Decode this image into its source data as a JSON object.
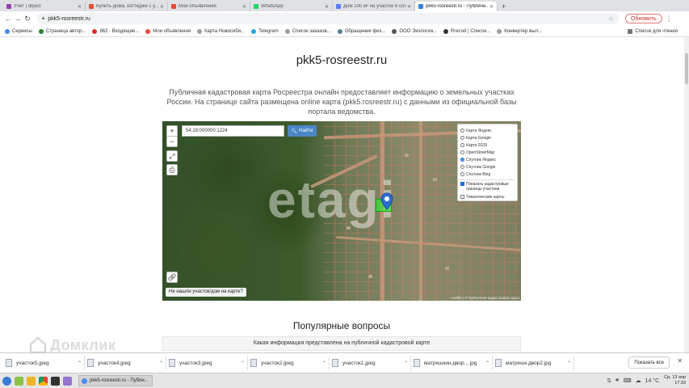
{
  "browser": {
    "tabs": [
      {
        "title": "Учет | object",
        "color": "#8e44ad",
        "active": false
      },
      {
        "title": "Купить дома, коттеджи с у...",
        "color": "#e74c3c",
        "active": false
      },
      {
        "title": "Мои объявления",
        "color": "#e74c3c",
        "active": false
      },
      {
        "title": "WhatsApp",
        "color": "#25d366",
        "active": false
      },
      {
        "title": "Дом 100 м² на участке 6 сот...",
        "color": "#5c7cfa",
        "active": false
      },
      {
        "title": "pkk5-rosreestr.ru - Публичн...",
        "color": "#3b7dd8",
        "active": true
      }
    ],
    "new_tab": "+",
    "url": "pkk5-rosreestr.ru",
    "update_label": "Обновить",
    "bookmarks": [
      {
        "label": "Сервисы",
        "color": "#4285f4"
      },
      {
        "label": "Страница автор...",
        "color": "#2e7d32"
      },
      {
        "label": "862 · Входящие...",
        "color": "#d93025"
      },
      {
        "label": "Мои объявления",
        "color": "#e74c3c"
      },
      {
        "label": "Карта Новосиби...",
        "color": "#9e9e9e"
      },
      {
        "label": "Telegram",
        "color": "#2aa3e0"
      },
      {
        "label": "Список заказов...",
        "color": "#9e9e9e"
      },
      {
        "label": "Обращение физ...",
        "color": "#607d8b"
      },
      {
        "label": "ООО Экология...",
        "color": "#555555"
      },
      {
        "label": "Rrecod | Список...",
        "color": "#333333"
      },
      {
        "label": "Конвертер выл...",
        "color": "#9e9e9e"
      }
    ],
    "reading_list": "Список для чтения"
  },
  "page": {
    "title": "pkk5-rosreestr.ru",
    "description": "Публичная кадастровая карта Росреестра онлайн предоставляет информацию о земельных участках России. На странице сайта размещена online карта (pkk5.rosreestr.ru) с данными из официальной базы портала ведомства.",
    "map": {
      "zoom_in": "+",
      "zoom_out": "−",
      "search_value": "54:19:000000:1224",
      "search_button": "Найти",
      "layers": [
        {
          "label": "Карта Яндекс",
          "selected": false
        },
        {
          "label": "Карта Google",
          "selected": false
        },
        {
          "label": "Карта 2GIS",
          "selected": false
        },
        {
          "label": "OpenStreetMap",
          "selected": false
        },
        {
          "label": "Спутник Яндекс",
          "selected": true
        },
        {
          "label": "Спутник Google",
          "selected": false
        },
        {
          "label": "Спутник Bing",
          "selected": false
        }
      ],
      "show_borders_label": "Показать кадастровые границы участков",
      "show_borders_checked": true,
      "thematic_label": "Тематические карты",
      "thematic_checked": false,
      "not_found_label": "Не нашли участок/дом на карте?",
      "attribution": "Leaflet | © Публичная кадастровая карта"
    },
    "watermark": "etagi",
    "faq_title": "Популярные вопросы",
    "faq_items": [
      "Какая информация представлена на публичной кадастровой карте"
    ]
  },
  "downloads": {
    "items": [
      "участок5.jpeg",
      "участок4.jpeg",
      "участок3.jpeg",
      "участок2.jpeg",
      "участок1.jpeg",
      "матрешкин.двор....jpg",
      "матрешк.двор2.jpg"
    ],
    "show_all": "Показать все"
  },
  "overlay_watermark": "Домклик",
  "taskbar": {
    "window_title": "pkk5-rosreestr.ru - Публи...",
    "temperature": "14 °C",
    "date": "Ср, 13 апр",
    "time": "17:33"
  }
}
